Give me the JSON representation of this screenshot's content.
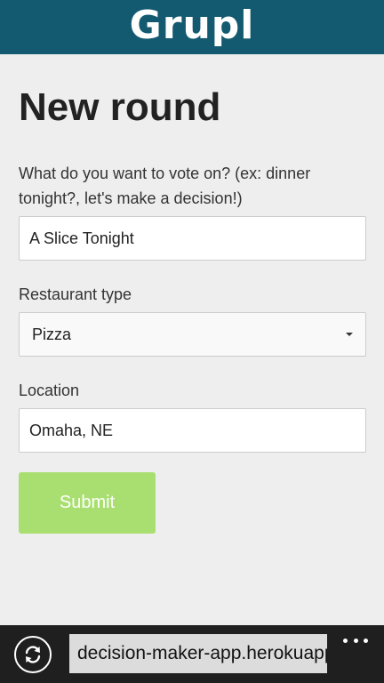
{
  "header": {
    "brand": "Grupl",
    "background_color": "#135a70"
  },
  "page": {
    "title": "New round"
  },
  "form": {
    "vote_label": "What do you want to vote on? (ex: dinner tonight?, let's make a decision!)",
    "vote_value": "A Slice Tonight",
    "type_label": "Restaurant type",
    "type_value": "Pizza",
    "location_label": "Location",
    "location_value": "Omaha, NE",
    "submit_label": "Submit",
    "submit_color": "#a9df70"
  },
  "browser": {
    "url": "decision-maker-app.herokuapp.com",
    "refresh_icon": "refresh-icon",
    "more_icon": "more-icon"
  }
}
